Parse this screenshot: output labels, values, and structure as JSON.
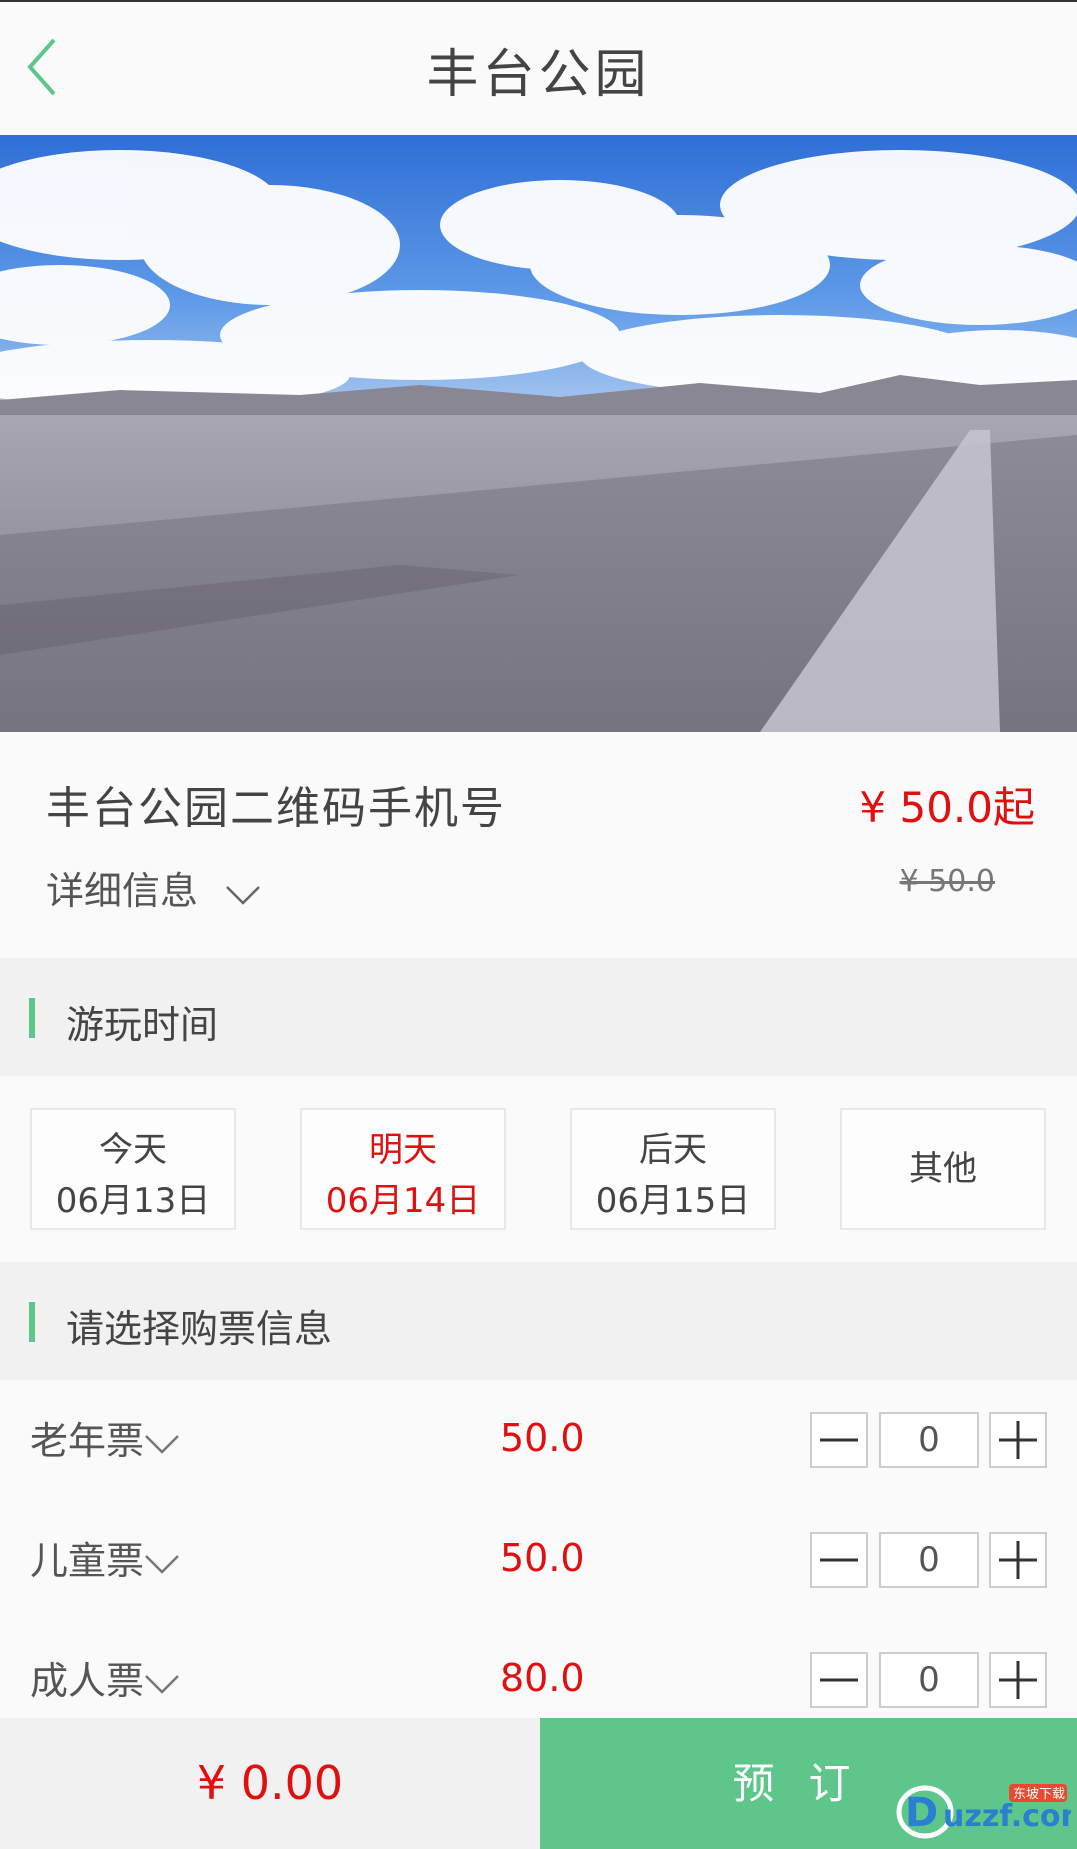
{
  "header": {
    "title": "丰台公园",
    "back_icon": "chevron-left-icon"
  },
  "product": {
    "name": "丰台公园二维码手机号",
    "price": "¥ 50.0起",
    "detail_label": "详细信息",
    "original_price": "¥ 50.0"
  },
  "play_time": {
    "section_title": "游玩时间",
    "dates": [
      {
        "day": "今天",
        "date": "06月13日",
        "selected": false
      },
      {
        "day": "明天",
        "date": "06月14日",
        "selected": true
      },
      {
        "day": "后天",
        "date": "06月15日",
        "selected": false
      }
    ],
    "other_label": "其他"
  },
  "tickets": {
    "section_title": "请选择购票信息",
    "items": [
      {
        "name": "老年票",
        "price": "50.0",
        "qty": "0"
      },
      {
        "name": "儿童票",
        "price": "50.0",
        "qty": "0"
      },
      {
        "name": "成人票",
        "price": "80.0",
        "qty": "0"
      }
    ]
  },
  "footer": {
    "total": "¥ 0.00",
    "book_label": "预订"
  },
  "watermark": {
    "text": "uzzf.com",
    "badge": "东坡下载"
  },
  "colors": {
    "accent": "#5ec68a",
    "price_red": "#e01010"
  }
}
